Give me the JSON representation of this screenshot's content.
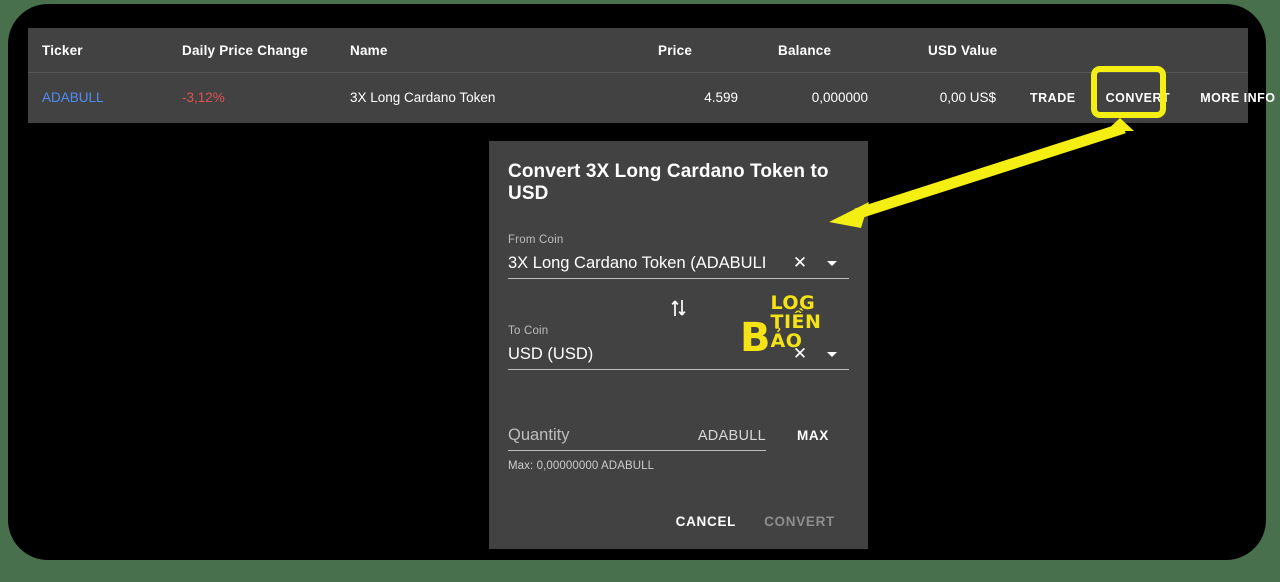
{
  "colors": {
    "page_background": "#49704d",
    "card_background": "#000000",
    "panel_background": "#424242",
    "ticker_link": "#4f8df5",
    "negative_change": "#e05252",
    "annotation": "#f5ee12",
    "watermark": "#f5e313",
    "disabled_text": "#8e8e8e"
  },
  "table": {
    "headers": {
      "ticker": "Ticker",
      "daily_price_change": "Daily Price Change",
      "name": "Name",
      "price": "Price",
      "balance": "Balance",
      "usd_value": "USD Value"
    },
    "row": {
      "ticker": "ADABULL",
      "daily_price_change": "-3,12%",
      "name": "3X Long Cardano Token",
      "price": "4.599",
      "balance": "0,000000",
      "usd_value": "0,00 US$"
    },
    "actions": {
      "trade": "TRADE",
      "convert": "CONVERT",
      "more_info": "MORE INFO"
    }
  },
  "dialog": {
    "title": "Convert 3X Long Cardano Token to USD",
    "from_coin": {
      "label": "From Coin",
      "value": "3X Long Cardano Token (ADABULI",
      "clear_icon": "close-icon",
      "dropdown_icon": "chevron-down-icon"
    },
    "swap_icon": "swap-vertical-icon",
    "to_coin": {
      "label": "To Coin",
      "value": "USD (USD)",
      "clear_icon": "close-icon",
      "dropdown_icon": "chevron-down-icon"
    },
    "quantity": {
      "placeholder": "Quantity",
      "value": "",
      "suffix": "ADABULL",
      "max_label": "MAX",
      "helper": "Max: 0,00000000 ADABULL"
    },
    "buttons": {
      "cancel": "CANCEL",
      "convert": "CONVERT"
    }
  },
  "watermark": {
    "symbol": "B",
    "text": "LOG TIỀN ẢO"
  },
  "annotation": {
    "highlight_target": "CONVERT",
    "arrow_icon": "arrow-pointer"
  }
}
